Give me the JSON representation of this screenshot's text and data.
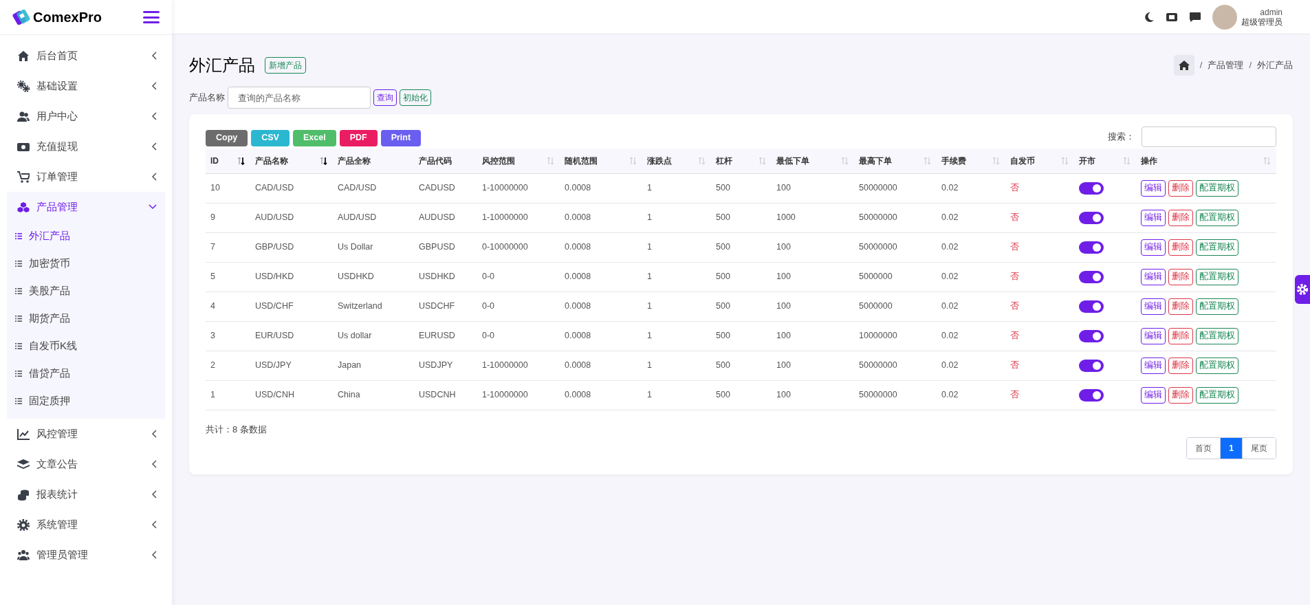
{
  "brand": {
    "name": "ComexPro"
  },
  "topbar": {
    "user_name": "admin",
    "user_role": "超级管理员"
  },
  "sidebar": {
    "items": [
      {
        "label": "后台首页",
        "selected": false,
        "expanded": false
      },
      {
        "label": "基础设置",
        "selected": false,
        "expanded": false
      },
      {
        "label": "用户中心",
        "selected": false,
        "expanded": false
      },
      {
        "label": "充值提现",
        "selected": false,
        "expanded": false
      },
      {
        "label": "订单管理",
        "selected": false,
        "expanded": false
      },
      {
        "label": "产品管理",
        "selected": true,
        "expanded": true,
        "children": [
          {
            "label": "外汇产品",
            "selected": true
          },
          {
            "label": "加密货币",
            "selected": false
          },
          {
            "label": "美股产品",
            "selected": false
          },
          {
            "label": "期货产品",
            "selected": false
          },
          {
            "label": "自发币K线",
            "selected": false
          },
          {
            "label": "借贷产品",
            "selected": false
          },
          {
            "label": "固定质押",
            "selected": false
          }
        ]
      },
      {
        "label": "风控管理",
        "selected": false,
        "expanded": false
      },
      {
        "label": "文章公告",
        "selected": false,
        "expanded": false
      },
      {
        "label": "报表统计",
        "selected": false,
        "expanded": false
      },
      {
        "label": "系统管理",
        "selected": false,
        "expanded": false
      },
      {
        "label": "管理员管理",
        "selected": false,
        "expanded": false
      }
    ]
  },
  "page": {
    "title": "外汇产品",
    "add_button": "新增产品",
    "breadcrumb_separator": "/",
    "breadcrumb": [
      "产品管理",
      "外汇产品"
    ]
  },
  "filter": {
    "label": "产品名称",
    "placeholder": "查询的产品名称",
    "search_button": "查询",
    "reset_button": "初始化"
  },
  "export_buttons": [
    {
      "label": "Copy",
      "color": "#6c6c6c"
    },
    {
      "label": "CSV",
      "color": "#2bb7d0"
    },
    {
      "label": "Excel",
      "color": "#50bd6a"
    },
    {
      "label": "PDF",
      "color": "#ea1d63"
    },
    {
      "label": "Print",
      "color": "#6a5ef0"
    }
  ],
  "table_search": {
    "label": "搜索："
  },
  "table": {
    "columns": [
      {
        "label": "ID",
        "sortable": true,
        "sorted": true
      },
      {
        "label": "产品名称",
        "sortable": true,
        "sorted": true
      },
      {
        "label": "产品全称",
        "sortable": false
      },
      {
        "label": "产品代码",
        "sortable": false
      },
      {
        "label": "风控范围",
        "sortable": true,
        "sorted": false
      },
      {
        "label": "随机范围",
        "sortable": true,
        "sorted": false
      },
      {
        "label": "涨跌点",
        "sortable": true,
        "sorted": false
      },
      {
        "label": "杠杆",
        "sortable": true,
        "sorted": false
      },
      {
        "label": "最低下单",
        "sortable": true,
        "sorted": false
      },
      {
        "label": "最高下单",
        "sortable": true,
        "sorted": false
      },
      {
        "label": "手续费",
        "sortable": true,
        "sorted": false
      },
      {
        "label": "自发币",
        "sortable": true,
        "sorted": false
      },
      {
        "label": "开市",
        "sortable": true,
        "sorted": false
      },
      {
        "label": "操作",
        "sortable": true,
        "sorted": false
      }
    ],
    "rows": [
      {
        "cells": [
          "10",
          "CAD/USD",
          "CAD/USD",
          "CADUSD",
          "1-10000000",
          "0.0008",
          "1",
          "500",
          "100",
          "50000000",
          "0.02",
          "否"
        ],
        "market_open": true,
        "actions": [
          "编辑",
          "删除",
          "配置期权"
        ]
      },
      {
        "cells": [
          "9",
          "AUD/USD",
          "AUD/USD",
          "AUDUSD",
          "1-10000000",
          "0.0008",
          "1",
          "500",
          "1000",
          "50000000",
          "0.02",
          "否"
        ],
        "market_open": true,
        "actions": [
          "编辑",
          "删除",
          "配置期权"
        ]
      },
      {
        "cells": [
          "7",
          "GBP/USD",
          "Us Dollar",
          "GBPUSD",
          "0-10000000",
          "0.0008",
          "1",
          "500",
          "100",
          "50000000",
          "0.02",
          "否"
        ],
        "market_open": true,
        "actions": [
          "编辑",
          "删除",
          "配置期权"
        ]
      },
      {
        "cells": [
          "5",
          "USD/HKD",
          "USDHKD",
          "USDHKD",
          "0-0",
          "0.0008",
          "1",
          "500",
          "100",
          "5000000",
          "0.02",
          "否"
        ],
        "market_open": true,
        "actions": [
          "编辑",
          "删除",
          "配置期权"
        ]
      },
      {
        "cells": [
          "4",
          "USD/CHF",
          "Switzerland",
          "USDCHF",
          "0-0",
          "0.0008",
          "1",
          "500",
          "100",
          "5000000",
          "0.02",
          "否"
        ],
        "market_open": true,
        "actions": [
          "编辑",
          "删除",
          "配置期权"
        ]
      },
      {
        "cells": [
          "3",
          "EUR/USD",
          "Us dollar",
          "EURUSD",
          "0-0",
          "0.0008",
          "1",
          "500",
          "100",
          "10000000",
          "0.02",
          "否"
        ],
        "market_open": true,
        "actions": [
          "编辑",
          "删除",
          "配置期权"
        ]
      },
      {
        "cells": [
          "2",
          "USD/JPY",
          "Japan",
          "USDJPY",
          "1-10000000",
          "0.0008",
          "1",
          "500",
          "100",
          "50000000",
          "0.02",
          "否"
        ],
        "market_open": true,
        "actions": [
          "编辑",
          "删除",
          "配置期权"
        ]
      },
      {
        "cells": [
          "1",
          "USD/CNH",
          "China",
          "USDCNH",
          "1-10000000",
          "0.0008",
          "1",
          "500",
          "100",
          "50000000",
          "0.02",
          "否"
        ],
        "market_open": true,
        "actions": [
          "编辑",
          "删除",
          "配置期权"
        ]
      }
    ]
  },
  "summary": "共计：8 条数据",
  "pagination": [
    {
      "label": "首页",
      "selected": false
    },
    {
      "label": "1",
      "selected": true
    },
    {
      "label": "尾页",
      "selected": false
    }
  ]
}
